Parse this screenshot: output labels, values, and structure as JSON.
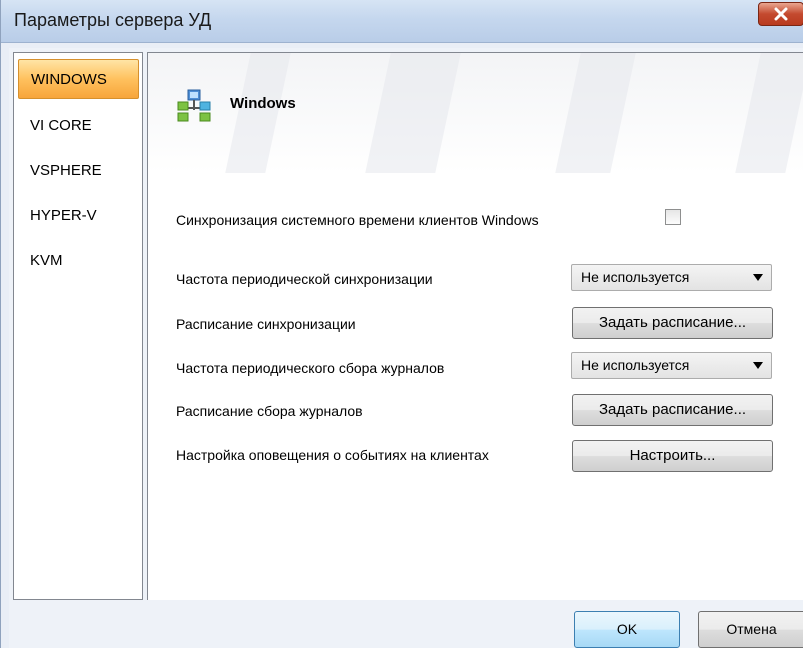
{
  "window": {
    "title": "Параметры сервера УД"
  },
  "sidebar": {
    "items": [
      {
        "label": "WINDOWS",
        "selected": true
      },
      {
        "label": "VI CORE"
      },
      {
        "label": "VSPHERE"
      },
      {
        "label": "HYPER-V"
      },
      {
        "label": "KVM"
      }
    ]
  },
  "panel": {
    "header": {
      "title": "Windows",
      "icon": "network-computers-icon"
    },
    "sync_time": {
      "label": "Синхронизация системного времени клиентов Windows",
      "checked": false
    },
    "sync_frequency": {
      "label": "Частота периодической синхронизации",
      "value": "Не используется"
    },
    "sync_schedule": {
      "label": "Расписание синхронизации",
      "button": "Задать расписание..."
    },
    "log_frequency": {
      "label": "Частота периодического сбора журналов",
      "value": "Не используется"
    },
    "log_schedule": {
      "label": "Расписание сбора журналов",
      "button": "Задать расписание..."
    },
    "notifications": {
      "label": "Настройка оповещения о событиях на клиентах",
      "button": "Настроить..."
    }
  },
  "footer": {
    "ok": "OK",
    "cancel": "Отмена"
  },
  "colors": {
    "selected_item": "#ffc15e",
    "close_button": "#c44a2f",
    "ok_button": "#bee6fd"
  }
}
